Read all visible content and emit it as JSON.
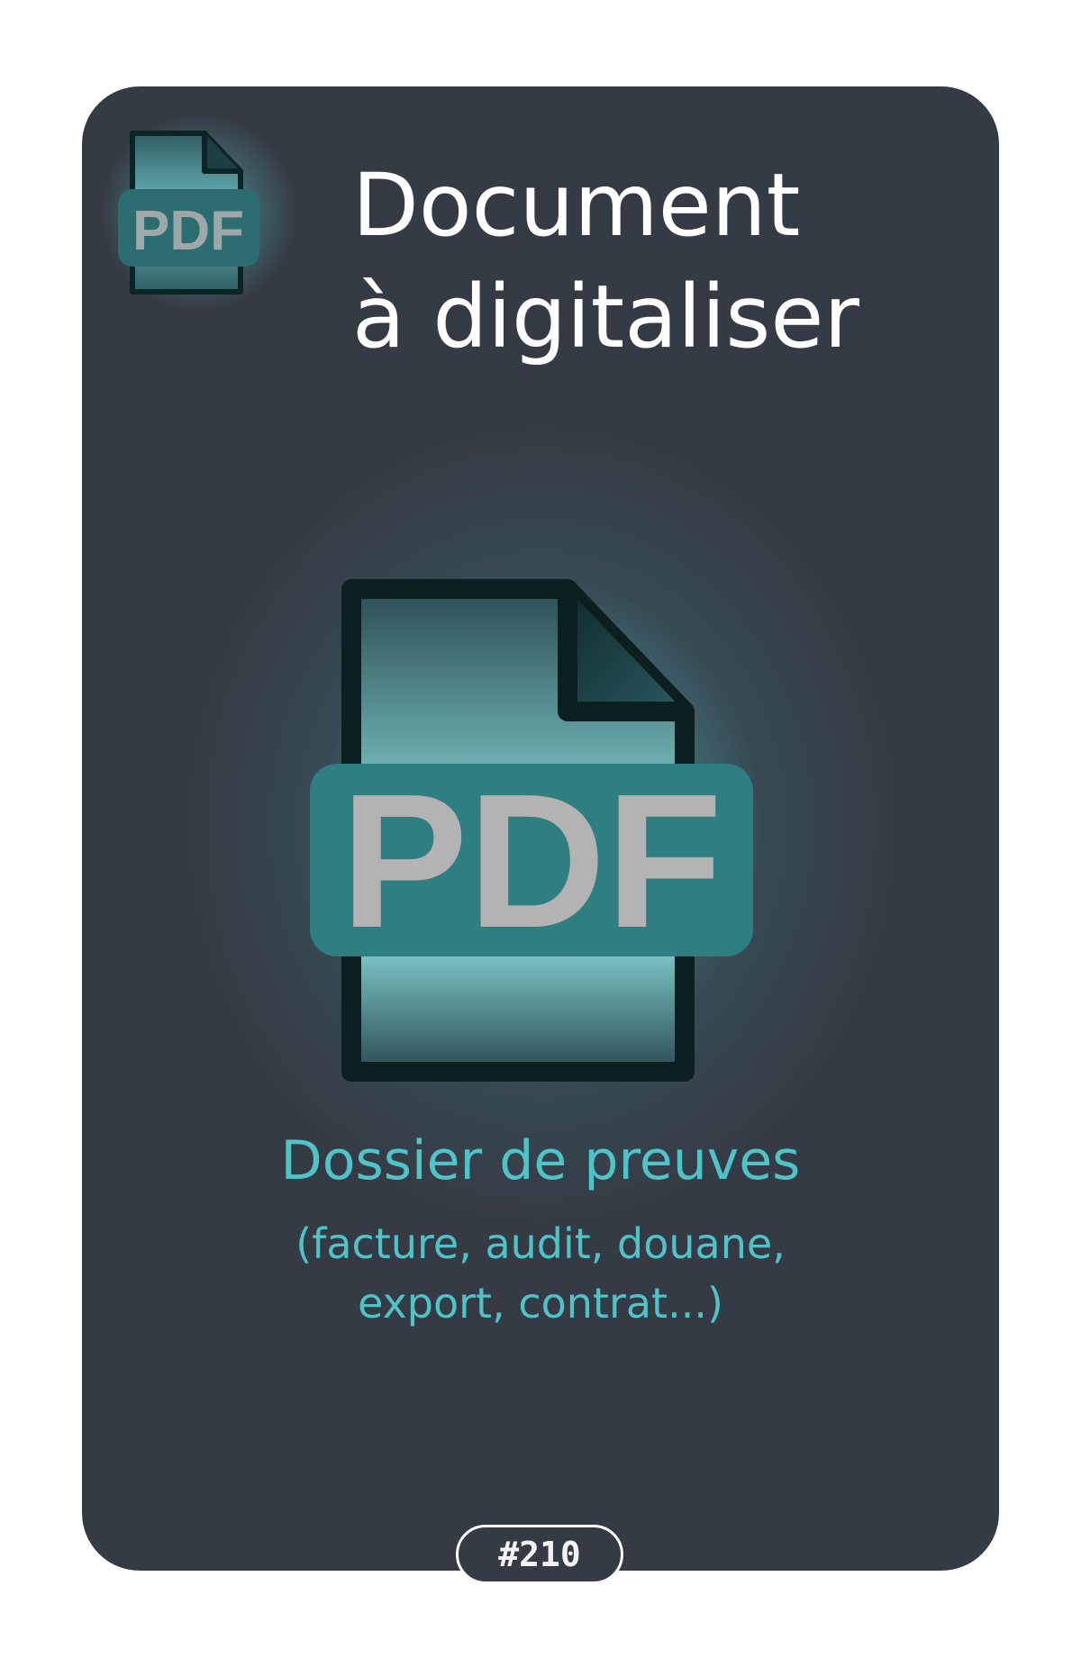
{
  "card": {
    "title_line1": "Document",
    "title_line2": "à digitaliser",
    "subtitle": "Dossier de preuves",
    "details_line1": "(facture, audit, douane,",
    "details_line2": "export, contrat...)",
    "badge_number": "#210"
  },
  "icons": {
    "small": "pdf-file-icon",
    "large": "pdf-file-icon",
    "label": "PDF"
  },
  "colors": {
    "card_background": "#353b45",
    "accent": "#4fc3c7",
    "title": "#ffffff",
    "icon_label": "#b3b3b3"
  }
}
